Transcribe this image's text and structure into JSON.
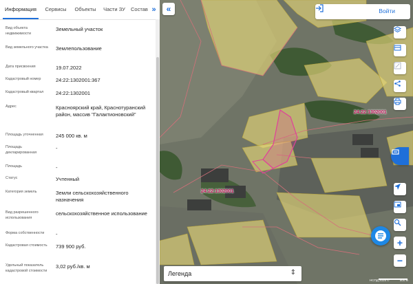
{
  "tabs": [
    {
      "label": "Информация",
      "active": true
    },
    {
      "label": "Сервисы",
      "active": false
    },
    {
      "label": "Объекты",
      "active": false
    },
    {
      "label": "Части ЗУ",
      "active": false
    },
    {
      "label": "Состав",
      "active": false
    }
  ],
  "rows": [
    {
      "label": "Вид объекта недвижимости",
      "value": "Земельный участок"
    },
    {
      "label": "Вид земельного участка",
      "value": "Землепользование"
    },
    {
      "label": "Дата присвоения",
      "value": "19.07.2022"
    },
    {
      "label": "Кадастровый номер",
      "value": "24:22:1302001:367"
    },
    {
      "label": "Кадастровый квартал",
      "value": "24:22:1302001"
    },
    {
      "label": "Адрес",
      "value": "Красноярский край, Краснотуранский район, массив \"Галактионовский\""
    },
    {
      "label": "Площадь уточненная",
      "value": "245 000 кв. м"
    },
    {
      "label": "Площадь декларированная",
      "value": "-"
    },
    {
      "label": "Площадь",
      "value": "-"
    },
    {
      "label": "Статус",
      "value": "Учтенный"
    },
    {
      "label": "Категория земель",
      "value": "Земли сельскохозяйственного назначения"
    },
    {
      "label": "Вид разрешенного использования",
      "value": "сельскохозяйственное использование"
    },
    {
      "label": "Форма собственности",
      "value": "-"
    },
    {
      "label": "Кадастровая стоимость",
      "value": "739 900 руб."
    },
    {
      "label": "Удельный показатель кадастровой стоимости",
      "value": "3,02 руб./кв. м"
    }
  ],
  "map": {
    "login_label": "Войти",
    "legend_label": "Легенда",
    "cadastral_labels": [
      "24:22:1302001",
      "24:22:1302001"
    ],
    "attribution": "НСПД 2025 ©",
    "scale_label": "500 м",
    "accent_color": "#1e6fd9",
    "highlight_color": "#e0409a"
  },
  "icons": {
    "tabs_scroll": "double-chevron-right-icon",
    "collapse": "double-chevron-left-icon",
    "login": "login-arrow-icon",
    "side_tools": [
      "layers-icon",
      "basemap-icon",
      "edit-icon",
      "share-icon",
      "print-icon",
      "services-icon",
      "navigate-icon",
      "measure-icon",
      "search-zoom-icon",
      "zoom-in-icon",
      "zoom-out-icon"
    ],
    "legend_toggle": "chevron-updown-icon",
    "chat": "chat-icon"
  }
}
